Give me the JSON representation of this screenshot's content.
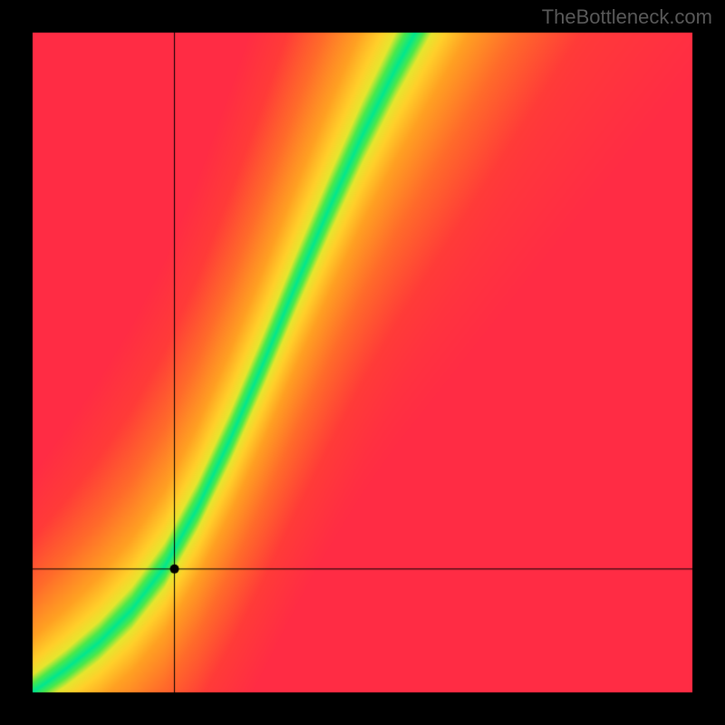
{
  "watermark": "TheBottleneck.com",
  "chart_data": {
    "type": "heatmap",
    "title": "",
    "xlabel": "",
    "ylabel": "",
    "xlim": [
      0,
      1
    ],
    "ylim": [
      0,
      1
    ],
    "border_color": "#000000",
    "border_width": 36,
    "plot_size": 728,
    "crosshair": {
      "x": 0.215,
      "y": 0.187
    },
    "marker": {
      "x": 0.215,
      "y": 0.187,
      "radius": 5,
      "color": "#000000"
    },
    "optimal_curve": [
      {
        "x": 0.0,
        "y": 0.0
      },
      {
        "x": 0.05,
        "y": 0.035
      },
      {
        "x": 0.1,
        "y": 0.075
      },
      {
        "x": 0.15,
        "y": 0.125
      },
      {
        "x": 0.2,
        "y": 0.19
      },
      {
        "x": 0.25,
        "y": 0.28
      },
      {
        "x": 0.3,
        "y": 0.385
      },
      {
        "x": 0.35,
        "y": 0.5
      },
      {
        "x": 0.4,
        "y": 0.62
      },
      {
        "x": 0.45,
        "y": 0.735
      },
      {
        "x": 0.5,
        "y": 0.845
      },
      {
        "x": 0.55,
        "y": 0.945
      },
      {
        "x": 0.58,
        "y": 1.0
      }
    ],
    "color_stops": [
      {
        "dist": 0.0,
        "color": "#00E78F"
      },
      {
        "dist": 0.04,
        "color": "#4CE84A"
      },
      {
        "dist": 0.08,
        "color": "#E6E62E"
      },
      {
        "dist": 0.14,
        "color": "#FFD02A"
      },
      {
        "dist": 0.25,
        "color": "#FFA022"
      },
      {
        "dist": 0.45,
        "color": "#FF6B2A"
      },
      {
        "dist": 0.7,
        "color": "#FF3B38"
      },
      {
        "dist": 1.0,
        "color": "#FF2C44"
      }
    ]
  }
}
